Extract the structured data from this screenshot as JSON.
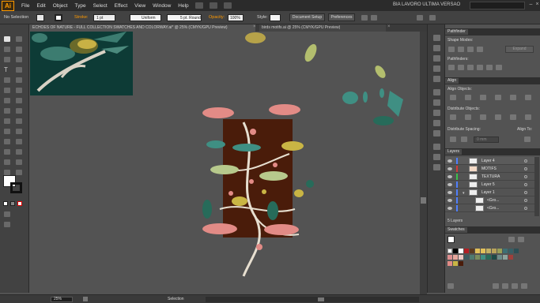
{
  "app": {
    "logo": "Ai",
    "workspace": "BIA LAVORO ULTIMA VERSAO"
  },
  "menus": [
    "File",
    "Edit",
    "Object",
    "Type",
    "Select",
    "Effect",
    "View",
    "Window",
    "Help"
  ],
  "control": {
    "selection": "No Selection",
    "stroke_label": "Stroke:",
    "stroke_value": "1 pt",
    "profile": "Uniform",
    "brush": "5 pt. Round",
    "opacity_label": "Opacity:",
    "opacity_value": "100%",
    "style_label": "Style:",
    "document_setup": "Document Setup",
    "preferences": "Preferences"
  },
  "tabs": [
    {
      "label": "ECHOES OF NATURE - FULL COLLECTION SWATCHES AND COLORWAY.ai* @ 25% (CMYK/GPU Preview)",
      "active": true
    },
    {
      "label": "birds motifs.ai @ 25% (CMYK/GPU Preview)",
      "active": false
    }
  ],
  "panels": {
    "pathfinder": {
      "title": "Pathfinder",
      "shape_modes": "Shape Modes:",
      "pathfinders": "Pathfinders:",
      "expand": "Expand"
    },
    "align": {
      "title": "Align",
      "align_objects": "Align Objects:",
      "distribute_objects": "Distribute Objects:",
      "distribute_spacing": "Distribute Spacing:",
      "align_to": "Align To:",
      "spacing_value": "0 mm"
    },
    "layers": {
      "title": "Layers",
      "rows": [
        {
          "name": "Layer 4",
          "color": "#4f7fff",
          "expanded": false,
          "selected": true
        },
        {
          "name": "MOTIFS",
          "color": "#d23b3b",
          "expanded": false
        },
        {
          "name": "TEXTURA",
          "color": "#3bbf4c",
          "expanded": false
        },
        {
          "name": "Layer 5",
          "color": "#4f7fff",
          "expanded": false
        },
        {
          "name": "Layer 1",
          "color": "#4f7fff",
          "expanded": true
        },
        {
          "name": "<Gro...",
          "color": "#4f7fff",
          "sub": true
        },
        {
          "name": "<Gro...",
          "color": "#4f7fff",
          "sub": true
        }
      ],
      "count": "5 Layers"
    },
    "swatches": {
      "title": "Swatches"
    }
  },
  "status": {
    "zoom": "25%",
    "tool": "Selection"
  },
  "colors": {
    "brand": "#ff9a00",
    "motif_background": "#4a1c0a",
    "teal": "#2f7d6d",
    "pink": "#e28b86",
    "yellow": "#c9b544",
    "dark_teal": "#0d3b36"
  }
}
